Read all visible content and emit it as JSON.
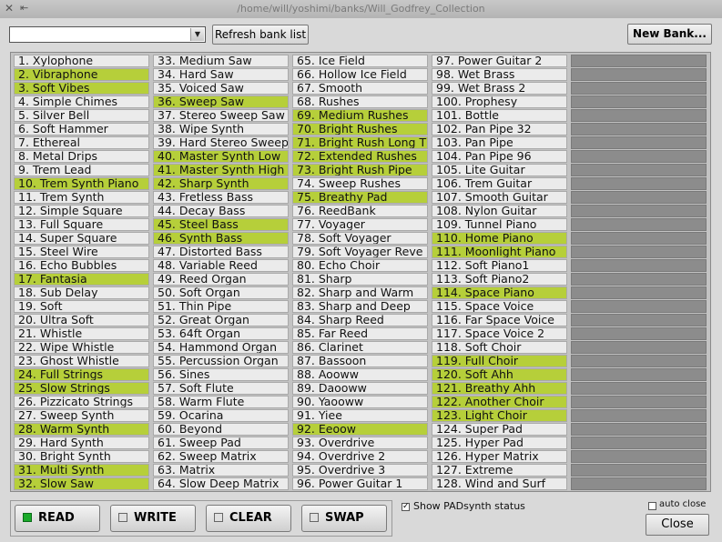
{
  "window": {
    "title": "/home/will/yoshimi/banks/Will_Godfrey_Collection"
  },
  "toolbar": {
    "combo_value": "",
    "refresh_label": "Refresh bank list",
    "new_bank_label": "New Bank..."
  },
  "colors": {
    "highlight": "#b6cf3a",
    "empty": "#8c8c8c",
    "cell": "#ebebeb",
    "led_on": "#1aaa2a"
  },
  "icons": {
    "close": "close-icon",
    "pin": "pin-icon",
    "dropdown": "chevron-down-icon"
  },
  "instruments": [
    {
      "label": "1. Xylophone",
      "hl": false
    },
    {
      "label": "2. Vibraphone",
      "hl": true
    },
    {
      "label": "3. Soft Vibes",
      "hl": true
    },
    {
      "label": "4. Simple Chimes",
      "hl": false
    },
    {
      "label": "5. Silver Bell",
      "hl": false
    },
    {
      "label": "6. Soft Hammer",
      "hl": false
    },
    {
      "label": "7. Ethereal",
      "hl": false
    },
    {
      "label": "8. Metal Drips",
      "hl": false
    },
    {
      "label": "9. Trem Lead",
      "hl": false
    },
    {
      "label": "10. Trem Synth Piano",
      "hl": true
    },
    {
      "label": "11. Trem Synth",
      "hl": false
    },
    {
      "label": "12. Simple Square",
      "hl": false
    },
    {
      "label": "13. Full Square",
      "hl": false
    },
    {
      "label": "14. Super Square",
      "hl": false
    },
    {
      "label": "15. Steel Wire",
      "hl": false
    },
    {
      "label": "16. Echo Bubbles",
      "hl": false
    },
    {
      "label": "17. Fantasia",
      "hl": true
    },
    {
      "label": "18. Sub Delay",
      "hl": false
    },
    {
      "label": "19. Soft",
      "hl": false
    },
    {
      "label": "20. Ultra Soft",
      "hl": false
    },
    {
      "label": "21. Whistle",
      "hl": false
    },
    {
      "label": "22. Wipe Whistle",
      "hl": false
    },
    {
      "label": "23. Ghost Whistle",
      "hl": false
    },
    {
      "label": "24. Full Strings",
      "hl": true
    },
    {
      "label": "25. Slow Strings",
      "hl": true
    },
    {
      "label": "26. Pizzicato Strings",
      "hl": false
    },
    {
      "label": "27. Sweep Synth",
      "hl": false
    },
    {
      "label": "28. Warm Synth",
      "hl": true
    },
    {
      "label": "29. Hard Synth",
      "hl": false
    },
    {
      "label": "30. Bright Synth",
      "hl": false
    },
    {
      "label": "31. Multi Synth",
      "hl": true
    },
    {
      "label": "32. Slow Saw",
      "hl": true
    },
    {
      "label": "33. Medium Saw",
      "hl": false
    },
    {
      "label": "34. Hard Saw",
      "hl": false
    },
    {
      "label": "35. Voiced Saw",
      "hl": false
    },
    {
      "label": "36. Sweep Saw",
      "hl": true
    },
    {
      "label": "37. Stereo Sweep Saw",
      "hl": false
    },
    {
      "label": "38. Wipe Synth",
      "hl": false
    },
    {
      "label": "39. Hard Stereo Sweep",
      "hl": false
    },
    {
      "label": "40. Master Synth Low",
      "hl": true
    },
    {
      "label": "41. Master Synth High",
      "hl": true
    },
    {
      "label": "42. Sharp Synth",
      "hl": true
    },
    {
      "label": "43. Fretless Bass",
      "hl": false
    },
    {
      "label": "44. Decay Bass",
      "hl": false
    },
    {
      "label": "45. Steel Bass",
      "hl": true
    },
    {
      "label": "46. Synth Bass",
      "hl": true
    },
    {
      "label": "47. Distorted Bass",
      "hl": false
    },
    {
      "label": "48. Variable Reed",
      "hl": false
    },
    {
      "label": "49. Reed Organ",
      "hl": false
    },
    {
      "label": "50. Soft Organ",
      "hl": false
    },
    {
      "label": "51. Thin Pipe",
      "hl": false
    },
    {
      "label": "52. Great Organ",
      "hl": false
    },
    {
      "label": "53. 64ft Organ",
      "hl": false
    },
    {
      "label": "54. Hammond Organ",
      "hl": false
    },
    {
      "label": "55. Percussion Organ",
      "hl": false
    },
    {
      "label": "56. Sines",
      "hl": false
    },
    {
      "label": "57. Soft Flute",
      "hl": false
    },
    {
      "label": "58. Warm Flute",
      "hl": false
    },
    {
      "label": "59. Ocarina",
      "hl": false
    },
    {
      "label": "60. Beyond",
      "hl": false
    },
    {
      "label": "61. Sweep Pad",
      "hl": false
    },
    {
      "label": "62. Sweep Matrix",
      "hl": false
    },
    {
      "label": "63. Matrix",
      "hl": false
    },
    {
      "label": "64. Slow Deep Matrix",
      "hl": false
    },
    {
      "label": "65. Ice Field",
      "hl": false
    },
    {
      "label": "66. Hollow Ice Field",
      "hl": false
    },
    {
      "label": "67. Smooth",
      "hl": false
    },
    {
      "label": "68. Rushes",
      "hl": false
    },
    {
      "label": "69. Medium Rushes",
      "hl": true
    },
    {
      "label": "70. Bright Rushes",
      "hl": true
    },
    {
      "label": "71. Bright Rush Long T",
      "hl": true
    },
    {
      "label": "72. Extended Rushes",
      "hl": true
    },
    {
      "label": "73. Bright Rush Pipe",
      "hl": true
    },
    {
      "label": "74. Sweep Rushes",
      "hl": false
    },
    {
      "label": "75. Breathy Pad",
      "hl": true
    },
    {
      "label": "76. ReedBank",
      "hl": false
    },
    {
      "label": "77. Voyager",
      "hl": false
    },
    {
      "label": "78. Soft Voyager",
      "hl": false
    },
    {
      "label": "79. Soft Voyager Reve",
      "hl": false
    },
    {
      "label": "80. Echo Choir",
      "hl": false
    },
    {
      "label": "81. Sharp",
      "hl": false
    },
    {
      "label": "82. Sharp and Warm",
      "hl": false
    },
    {
      "label": "83. Sharp and Deep",
      "hl": false
    },
    {
      "label": "84. Sharp Reed",
      "hl": false
    },
    {
      "label": "85. Far Reed",
      "hl": false
    },
    {
      "label": "86. Clarinet",
      "hl": false
    },
    {
      "label": "87. Bassoon",
      "hl": false
    },
    {
      "label": "88. Aooww",
      "hl": false
    },
    {
      "label": "89. Daooww",
      "hl": false
    },
    {
      "label": "90. Yaooww",
      "hl": false
    },
    {
      "label": "91. Yiee",
      "hl": false
    },
    {
      "label": "92. Eeoow",
      "hl": true
    },
    {
      "label": "93. Overdrive",
      "hl": false
    },
    {
      "label": "94. Overdrive 2",
      "hl": false
    },
    {
      "label": "95. Overdrive 3",
      "hl": false
    },
    {
      "label": "96. Power Guitar 1",
      "hl": false
    },
    {
      "label": "97. Power Guitar 2",
      "hl": false
    },
    {
      "label": "98. Wet Brass",
      "hl": false
    },
    {
      "label": "99. Wet Brass 2",
      "hl": false
    },
    {
      "label": "100. Prophesy",
      "hl": false
    },
    {
      "label": "101. Bottle",
      "hl": false
    },
    {
      "label": "102. Pan Pipe 32",
      "hl": false
    },
    {
      "label": "103. Pan Pipe",
      "hl": false
    },
    {
      "label": "104. Pan Pipe 96",
      "hl": false
    },
    {
      "label": "105. Lite Guitar",
      "hl": false
    },
    {
      "label": "106. Trem Guitar",
      "hl": false
    },
    {
      "label": "107. Smooth Guitar",
      "hl": false
    },
    {
      "label": "108. Nylon Guitar",
      "hl": false
    },
    {
      "label": "109. Tunnel Piano",
      "hl": false
    },
    {
      "label": "110. Home Piano",
      "hl": true
    },
    {
      "label": "111. Moonlight Piano",
      "hl": true
    },
    {
      "label": "112. Soft Piano1",
      "hl": false
    },
    {
      "label": "113. Soft Piano2",
      "hl": false
    },
    {
      "label": "114. Space Piano",
      "hl": true
    },
    {
      "label": "115. Space Voice",
      "hl": false
    },
    {
      "label": "116. Far Space Voice",
      "hl": false
    },
    {
      "label": "117. Space Voice 2",
      "hl": false
    },
    {
      "label": "118. Soft Choir",
      "hl": false
    },
    {
      "label": "119. Full Choir",
      "hl": true
    },
    {
      "label": "120. Soft Ahh",
      "hl": true
    },
    {
      "label": "121. Breathy Ahh",
      "hl": true
    },
    {
      "label": "122. Another Choir",
      "hl": true
    },
    {
      "label": "123. Light Choir",
      "hl": true
    },
    {
      "label": "124. Super Pad",
      "hl": false
    },
    {
      "label": "125. Hyper Pad",
      "hl": false
    },
    {
      "label": "126. Hyper Matrix",
      "hl": false
    },
    {
      "label": "127. Extreme",
      "hl": false
    },
    {
      "label": "128. Wind and Surf",
      "hl": false
    }
  ],
  "empty_slots": 32,
  "modes": [
    {
      "label": "READ",
      "active": true
    },
    {
      "label": "WRITE",
      "active": false
    },
    {
      "label": "CLEAR",
      "active": false
    },
    {
      "label": "SWAP",
      "active": false
    }
  ],
  "options": {
    "show_padsynth_label": "Show PADsynth status",
    "show_padsynth_checked": true,
    "auto_close_label": "auto close",
    "auto_close_checked": false
  },
  "footer": {
    "close_label": "Close"
  }
}
